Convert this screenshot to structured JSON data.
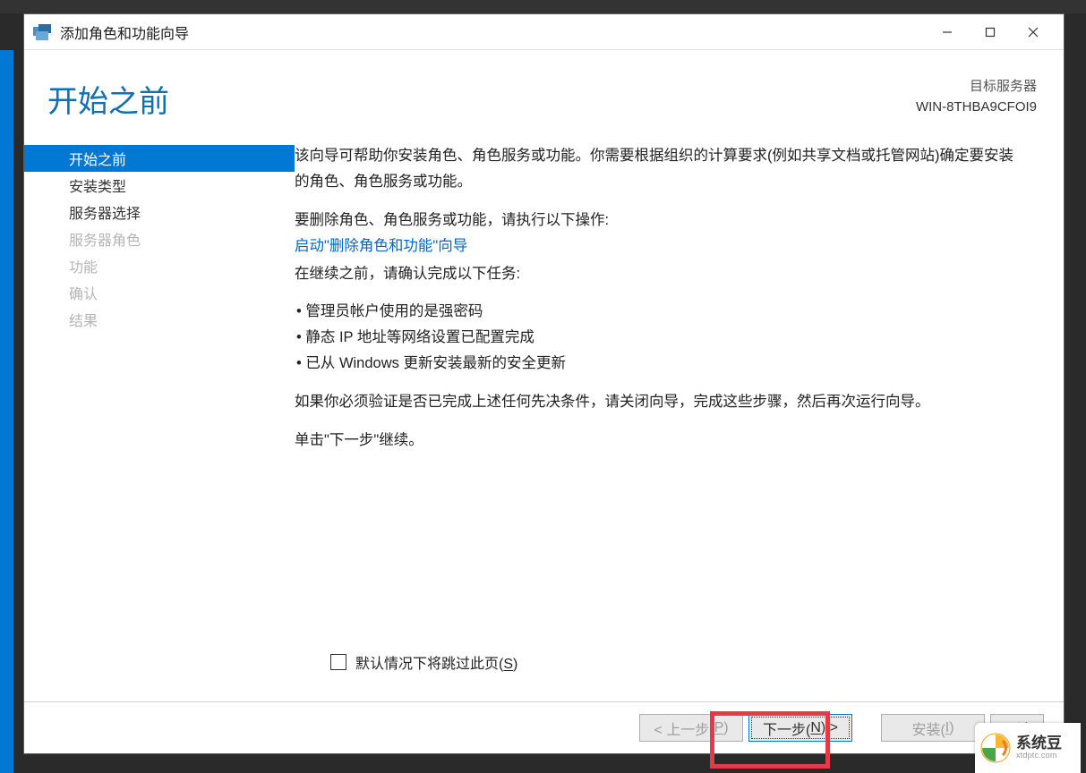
{
  "window": {
    "title": "添加角色和功能向导"
  },
  "header": {
    "page_title": "开始之前",
    "target_label": "目标服务器",
    "target_name": "WIN-8THBA9CFOI9"
  },
  "sidebar": {
    "items": [
      {
        "label": "开始之前",
        "state": "active"
      },
      {
        "label": "安装类型",
        "state": "normal"
      },
      {
        "label": "服务器选择",
        "state": "normal"
      },
      {
        "label": "服务器角色",
        "state": "disabled"
      },
      {
        "label": "功能",
        "state": "disabled"
      },
      {
        "label": "确认",
        "state": "disabled"
      },
      {
        "label": "结果",
        "state": "disabled"
      }
    ]
  },
  "content": {
    "intro": "该向导可帮助你安装角色、角色服务或功能。你需要根据组织的计算要求(例如共享文档或托管网站)确定要安装的角色、角色服务或功能。",
    "remove_label": "要删除角色、角色服务或功能，请执行以下操作:",
    "remove_link": "启动\"删除角色和功能\"向导",
    "confirm_label": "在继续之前，请确认完成以下任务:",
    "bullets": [
      "• 管理员帐户使用的是强密码",
      "• 静态 IP 地址等网络设置已配置完成",
      "• 已从 Windows 更新安装最新的安全更新"
    ],
    "verify": "如果你必须验证是否已完成上述任何先决条件，请关闭向导，完成这些步骤，然后再次运行向导。",
    "continue": "单击\"下一步\"继续。",
    "skip_prefix": "默认情况下将跳过此页(",
    "skip_u": "S",
    "skip_suffix": ")"
  },
  "footer": {
    "prev_prefix": "< 上一步(",
    "prev_u": "P",
    "prev_suffix": ")",
    "next_prefix": "下一步(",
    "next_u": "N",
    "next_suffix": ") >",
    "install_prefix": "安装(",
    "install_u": "I",
    "install_suffix": ")",
    "cancel": "取消"
  },
  "watermark": {
    "title": "系统豆",
    "url": "xtdptc.com"
  }
}
